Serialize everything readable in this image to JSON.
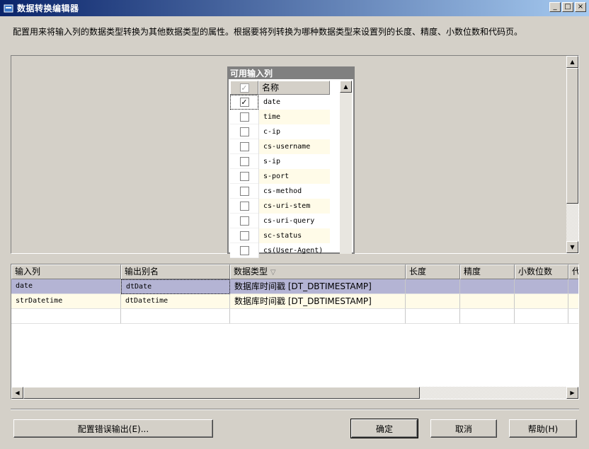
{
  "window": {
    "title": "数据转换编辑器",
    "minimize": "_",
    "maximize": "□",
    "close": "×"
  },
  "description": "配置用来将输入列的数据类型转换为其他数据类型的属性。根据要将列转换为哪种数据类型来设置列的长度、精度、小数位数和代码页。",
  "available_columns": {
    "title": "可用输入列",
    "header_name": "名称",
    "rows": [
      {
        "name": "date",
        "checked": true
      },
      {
        "name": "time",
        "checked": false
      },
      {
        "name": "c-ip",
        "checked": false
      },
      {
        "name": "cs-username",
        "checked": false
      },
      {
        "name": "s-ip",
        "checked": false
      },
      {
        "name": "s-port",
        "checked": false
      },
      {
        "name": "cs-method",
        "checked": false
      },
      {
        "name": "cs-uri-stem",
        "checked": false
      },
      {
        "name": "cs-uri-query",
        "checked": false
      },
      {
        "name": "sc-status",
        "checked": false
      },
      {
        "name": "cs(User-Agent)",
        "checked": false
      }
    ]
  },
  "grid": {
    "headers": [
      "输入列",
      "输出别名",
      "数据类型",
      "长度",
      "精度",
      "小数位数",
      "代"
    ],
    "sort_indicator": "▽",
    "rows": [
      {
        "input": "date",
        "alias": "dtDate",
        "type": "数据库时间戳 [DT_DBTIMESTAMP]",
        "length": "",
        "precision": "",
        "scale": "",
        "code": ""
      },
      {
        "input": "strDatetime",
        "alias": "dtDatetime",
        "type": "数据库时间戳 [DT_DBTIMESTAMP]",
        "length": "",
        "precision": "",
        "scale": "",
        "code": ""
      }
    ]
  },
  "buttons": {
    "config_error": "配置错误输出(E)...",
    "ok": "确定",
    "cancel": "取消",
    "help": "帮助(H)"
  }
}
